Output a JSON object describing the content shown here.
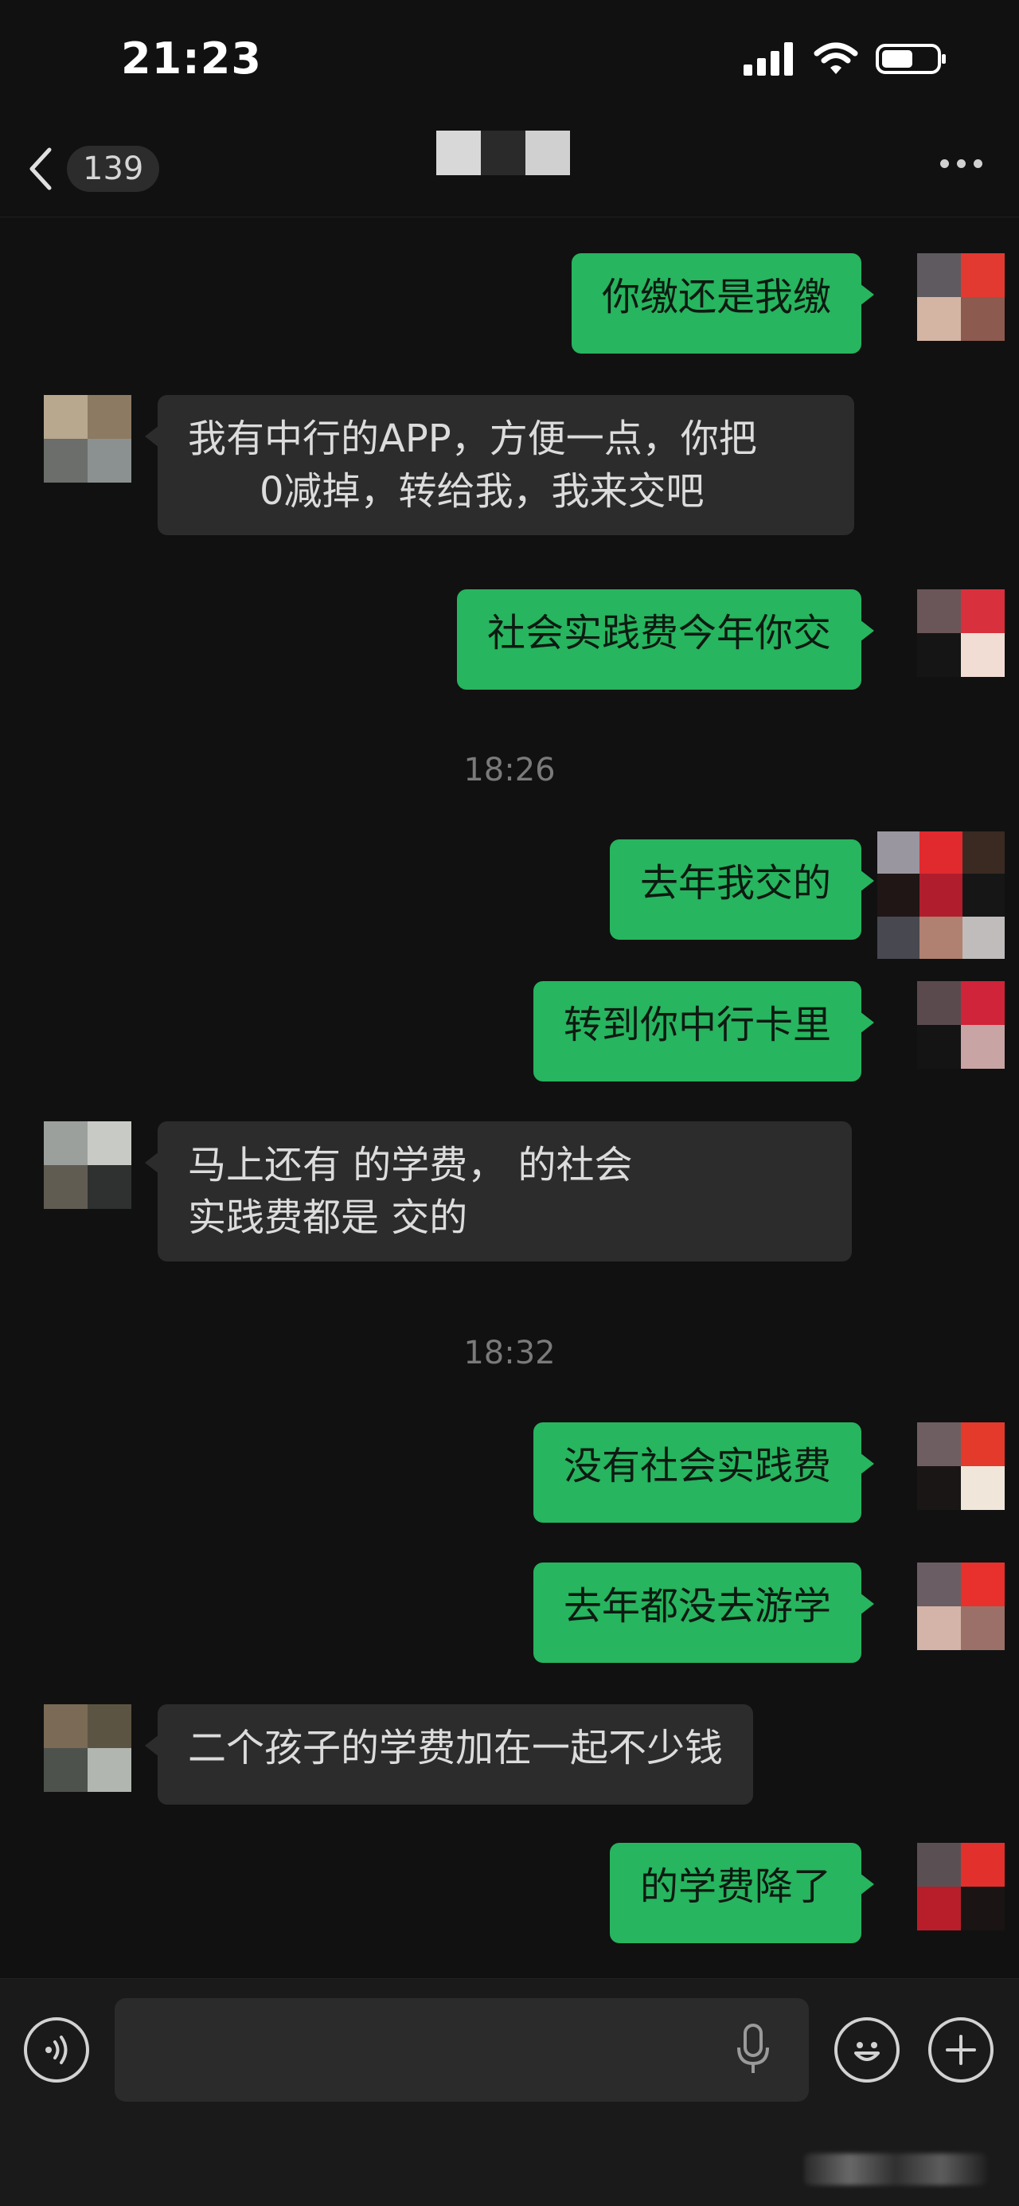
{
  "status_bar": {
    "time": "21:23"
  },
  "nav": {
    "unread_count": "139"
  },
  "icons": {
    "back": "chevron-left-icon",
    "more": "more-dots-icon",
    "signal": "signal-bars-icon",
    "wifi": "wifi-icon",
    "battery": "battery-icon",
    "voice": "voice-mode-icon",
    "mic": "microphone-icon",
    "emoji": "emoji-icon",
    "add": "plus-icon"
  },
  "colors": {
    "background": "#111111",
    "sent_bubble": "#27b55f",
    "received_bubble": "#2c2c2c"
  },
  "messages": [
    {
      "side": "sent",
      "text": "你缴还是我缴"
    },
    {
      "side": "received",
      "line1": "我有中行的APP，方便一点，你把",
      "line2": "0减掉，转给我，我来交吧"
    },
    {
      "side": "sent",
      "text": "社会实践费今年你交"
    },
    {
      "timestamp": "18:26"
    },
    {
      "side": "sent",
      "text": "去年我交的"
    },
    {
      "side": "sent",
      "text": "转到你中行卡里"
    },
    {
      "side": "received",
      "line1": "马上还有 的学费， 的社会",
      "line2": "实践费都是 交的"
    },
    {
      "timestamp": "18:32"
    },
    {
      "side": "sent",
      "text": "没有社会实践费"
    },
    {
      "side": "sent",
      "text": "去年都没去游学"
    },
    {
      "side": "received",
      "text": "二个孩子的学费加在一起不少钱"
    },
    {
      "side": "sent",
      "text": "的学费降了"
    }
  ]
}
